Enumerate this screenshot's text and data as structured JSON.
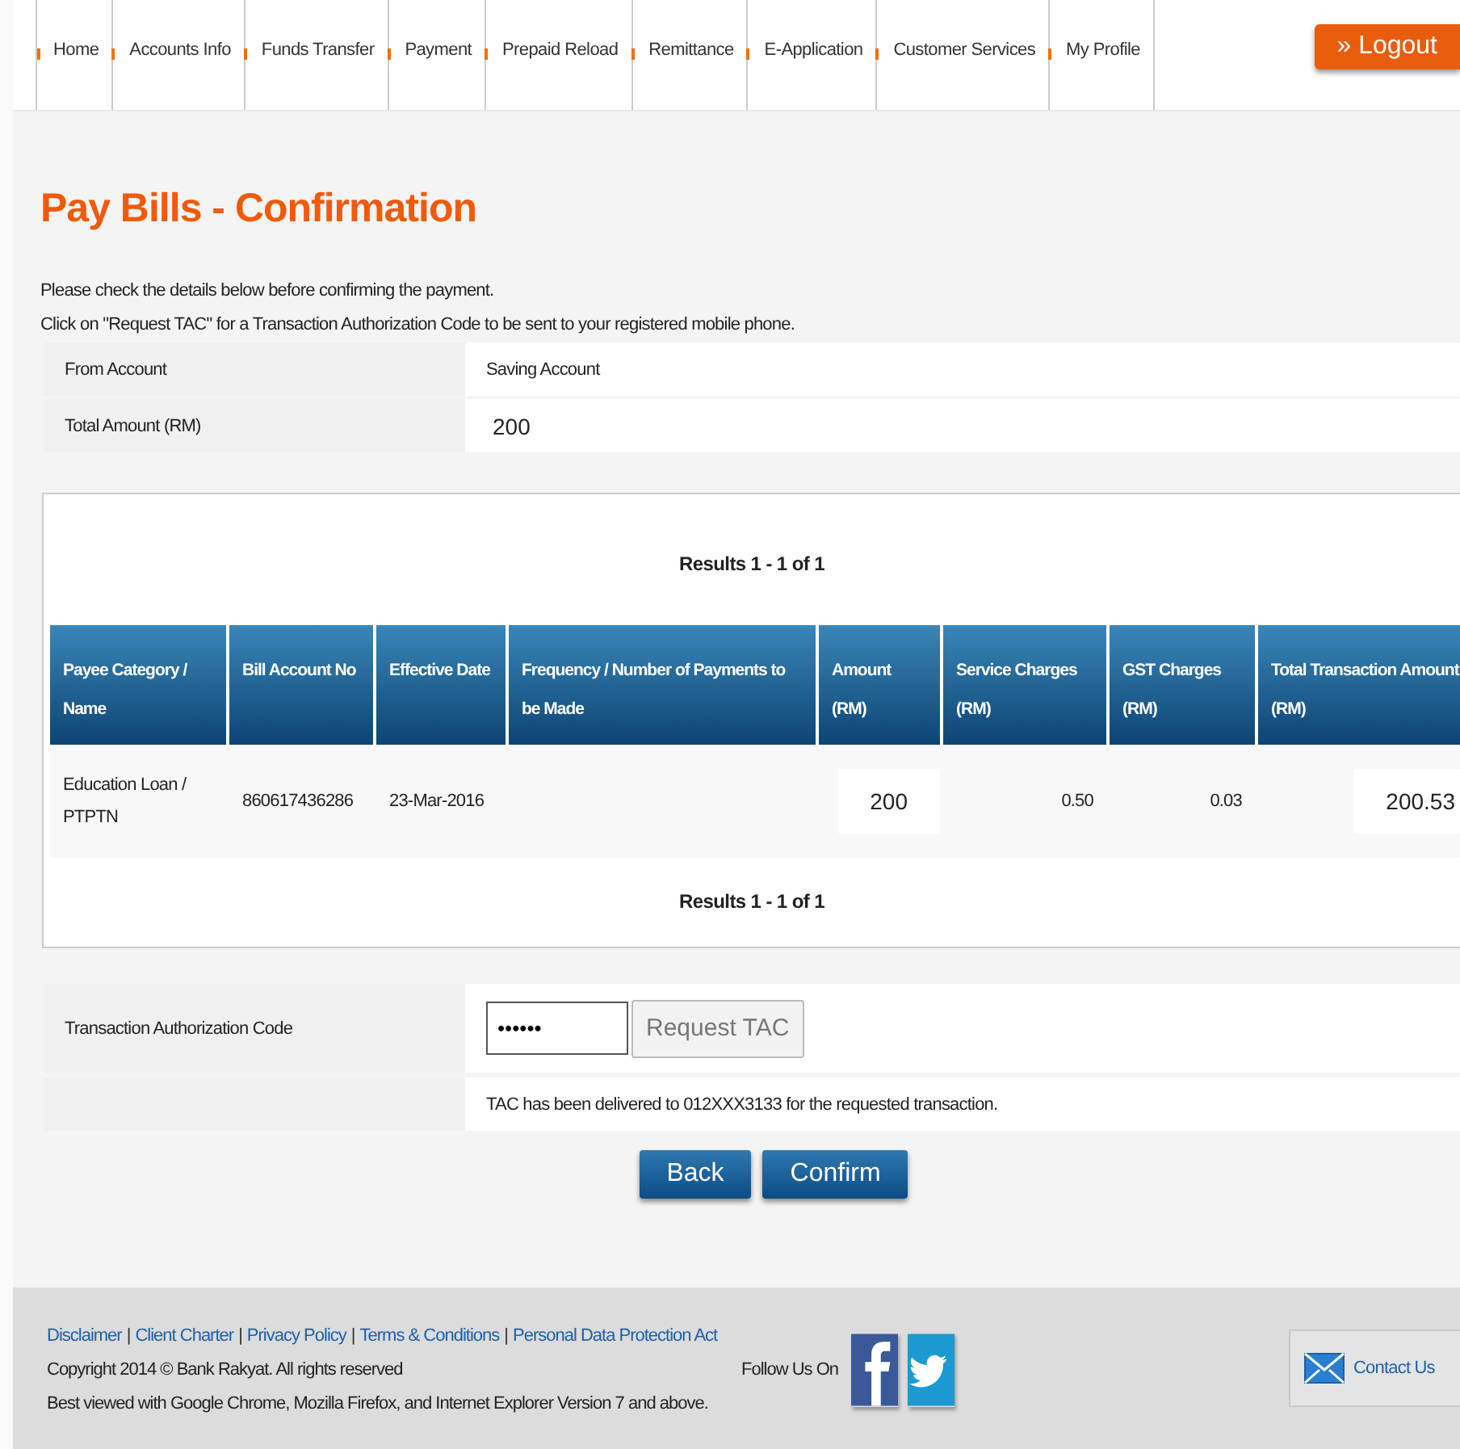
{
  "nav": {
    "items": [
      {
        "label": "Home"
      },
      {
        "label": "Accounts Info"
      },
      {
        "label": "Funds Transfer"
      },
      {
        "label": "Payment"
      },
      {
        "label": "Prepaid Reload"
      },
      {
        "label": "Remittance"
      },
      {
        "label": "E-Application"
      },
      {
        "label": "Customer Services"
      },
      {
        "label": "My Profile"
      }
    ],
    "logout": "» Logout"
  },
  "title": "Pay Bills - Confirmation",
  "instructions": [
    "Please check the details below before confirming the payment.",
    "Click on \"Request TAC\" for a Transaction Authorization Code to be sent to your registered mobile phone."
  ],
  "details": [
    {
      "label": "From Account",
      "value": "Saving Account",
      "kind": "text"
    },
    {
      "label": "Total Amount (RM)",
      "value": "200",
      "kind": "boxed"
    }
  ],
  "results": {
    "summary_top": "Results 1 - 1 of 1",
    "summary_bottom": "Results 1 - 1 of 1",
    "columns": [
      "Payee Category / Name",
      "Bill Account No",
      "Effective Date",
      "Frequency / Number of Payments to be Made",
      "Amount (RM)",
      "Service Charges (RM)",
      "GST Charges (RM)",
      "Total Transaction Amount (RM)"
    ],
    "rows": [
      [
        {
          "text": "Education Loan / PTPTN",
          "kind": "text"
        },
        {
          "text": "860617436286",
          "kind": "text"
        },
        {
          "text": "23-Mar-2016",
          "kind": "text"
        },
        {
          "text": "",
          "kind": "text"
        },
        {
          "text": "200",
          "kind": "boxed"
        },
        {
          "text": "0.50",
          "kind": "number"
        },
        {
          "text": "0.03",
          "kind": "number"
        },
        {
          "text": "200.53",
          "kind": "boxed"
        }
      ]
    ]
  },
  "tac": {
    "label": "Transaction Authorization Code",
    "value": "••••••",
    "request_button": {
      "label": "Request TAC",
      "disabled": true
    },
    "message": "TAC has been delivered to 012XXX3133 for the requested transaction."
  },
  "buttons": [
    "Back",
    "Confirm"
  ],
  "footer": {
    "links": [
      "Disclaimer",
      "Client Charter",
      "Privacy Policy",
      "Terms & Conditions",
      "Personal Data Protection Act"
    ],
    "separator": "|",
    "copyright": "Copyright 2014 © Bank Rakyat. All rights reserved",
    "browsers": "Best viewed with Google Chrome, Mozilla Firefox, and Internet Explorer Version 7 and above.",
    "follow": "Follow Us On",
    "contact": "Contact Us"
  }
}
